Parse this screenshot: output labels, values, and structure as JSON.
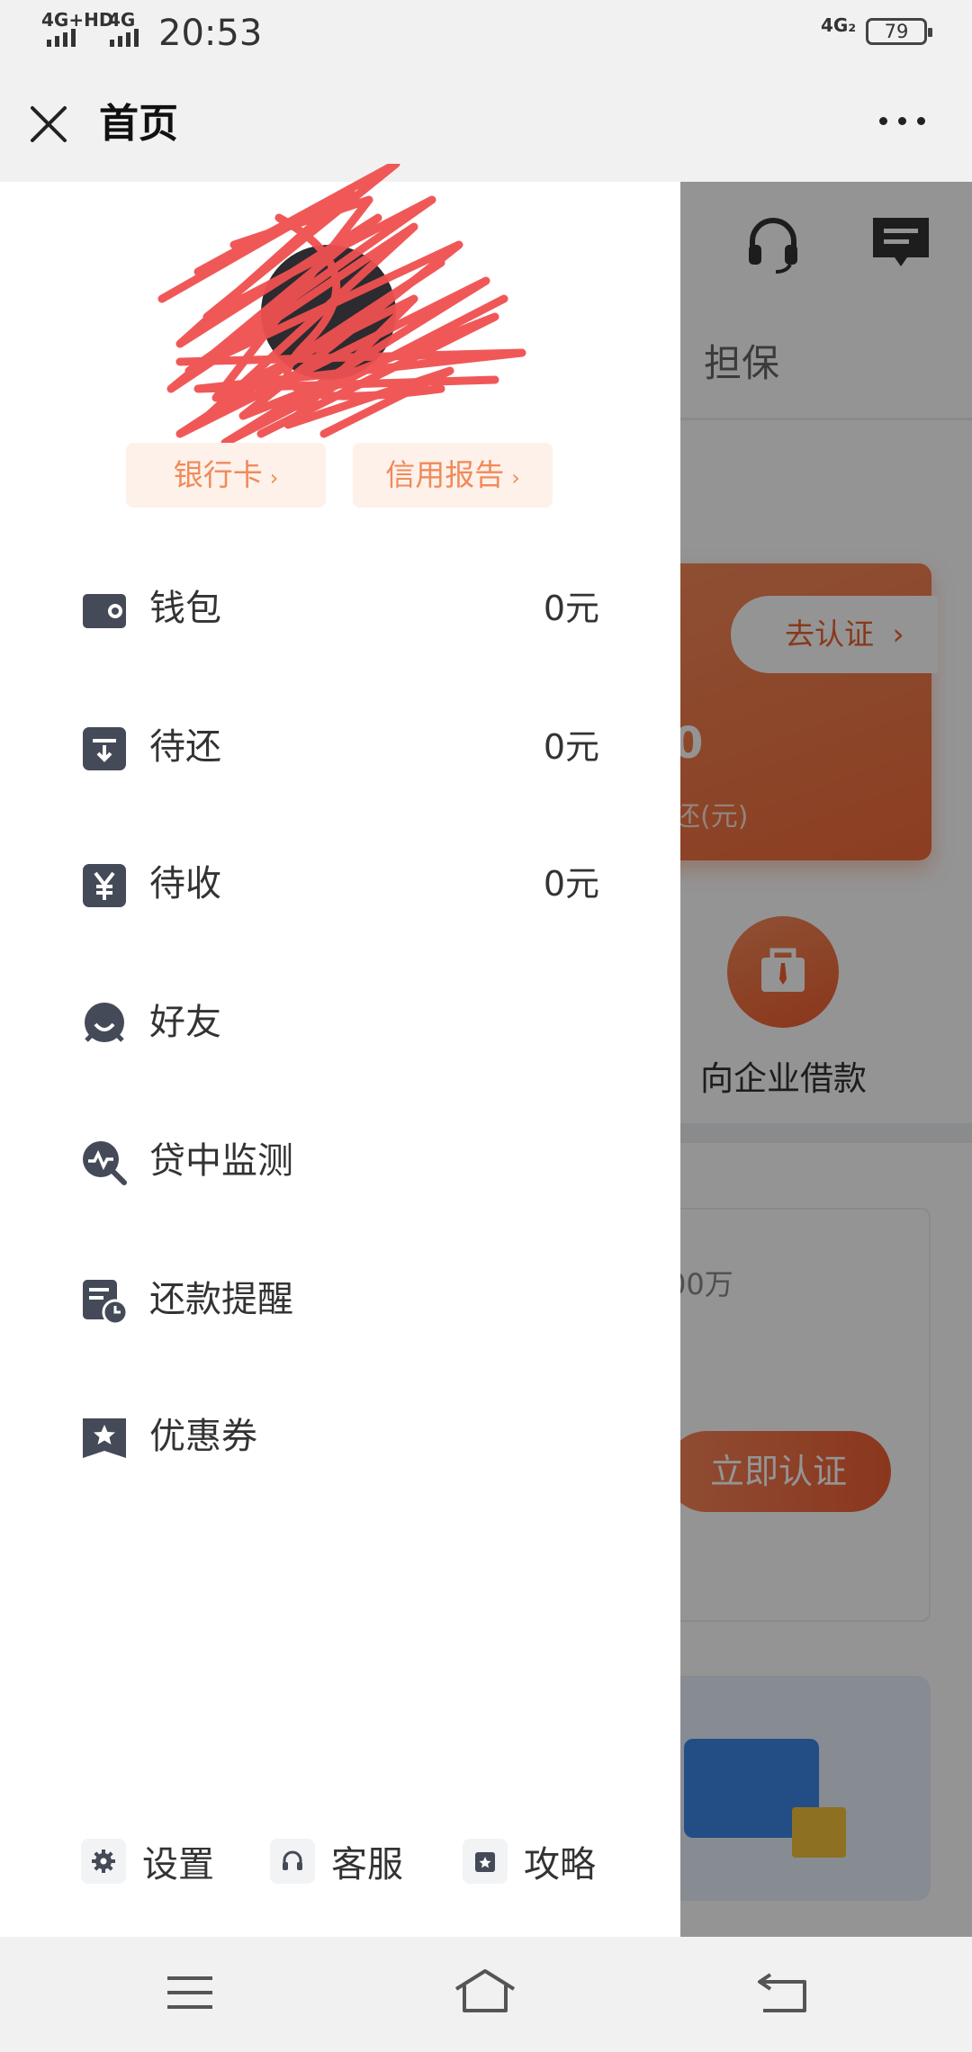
{
  "status_bar": {
    "network_left": "4G+HD",
    "network_mid": "4G",
    "time": "20:53",
    "network_right": "4G₂",
    "battery": "79"
  },
  "nav": {
    "title": "首页",
    "close_icon": "close-icon",
    "more_icon": "more-dots-icon"
  },
  "background_page": {
    "tab_label": "担保",
    "verify_button": "去认证",
    "card_number": "0",
    "card_sub": "还(元)",
    "enterprise_loan": "向企业借款",
    "amount_hint": "00万",
    "certify_button": "立即认证"
  },
  "drawer": {
    "chips": {
      "bank_card": "银行卡",
      "credit_report": "信用报告",
      "arrow": "›"
    },
    "menu": [
      {
        "icon": "wallet-icon",
        "label": "钱包",
        "value": "0元"
      },
      {
        "icon": "repay-pending-icon",
        "label": "待还",
        "value": "0元"
      },
      {
        "icon": "yuan-icon",
        "label": "待收",
        "value": "0元"
      },
      {
        "icon": "friend-icon",
        "label": "好友",
        "value": ""
      },
      {
        "icon": "monitor-icon",
        "label": "贷中监测",
        "value": ""
      },
      {
        "icon": "reminder-icon",
        "label": "还款提醒",
        "value": ""
      },
      {
        "icon": "coupon-icon",
        "label": "优惠券",
        "value": ""
      }
    ],
    "footer": {
      "settings": "设置",
      "service": "客服",
      "guide": "攻略"
    }
  },
  "colors": {
    "accent_orange": "#f06b3a",
    "chip_bg": "#fdf1ea",
    "chip_text": "#f08a5a",
    "icon_dark": "#444a57",
    "overlay": "rgba(0,0,0,0.42)"
  }
}
